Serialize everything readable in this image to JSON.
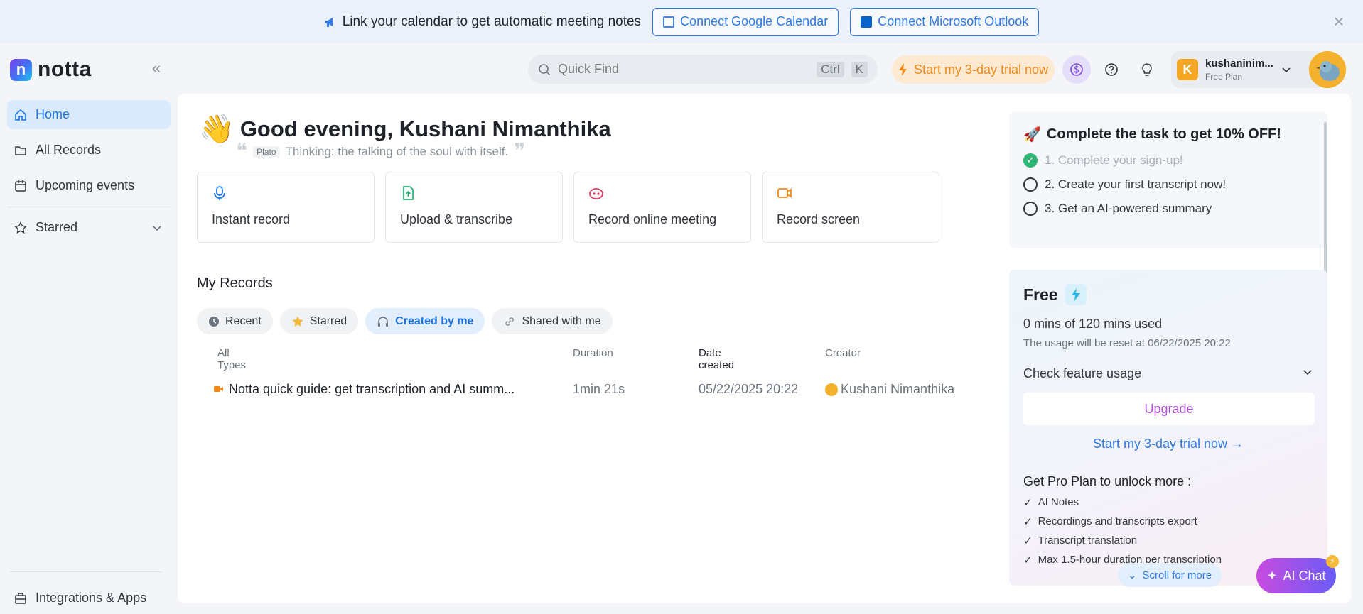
{
  "banner": {
    "text": "Link your calendar to get automatic meeting notes",
    "google_btn": "Connect Google Calendar",
    "outlook_btn": "Connect Microsoft Outlook",
    "close": "×"
  },
  "sidebar": {
    "logo": "notta",
    "logo_mark": "n",
    "collapse": "«",
    "items": [
      {
        "label": "Home"
      },
      {
        "label": "All Records"
      },
      {
        "label": "Upcoming events"
      },
      {
        "label": "Starred"
      }
    ],
    "integrations": "Integrations & Apps"
  },
  "header": {
    "search_placeholder": "Quick Find",
    "kbd_ctrl": "Ctrl",
    "kbd_k": "K",
    "trial": "Start my 3-day trial now",
    "user_initial": "K",
    "user_name": "kushaninim...",
    "user_plan": "Free Plan"
  },
  "main": {
    "greeting": "Good evening, Kushani Nimanthika",
    "quote_author": "Plato",
    "quote_text": "Thinking: the talking of the soul with itself.",
    "actions": [
      {
        "label": "Instant record"
      },
      {
        "label": "Upload & transcribe"
      },
      {
        "label": "Record online meeting"
      },
      {
        "label": "Record screen"
      }
    ],
    "my_records": "My Records",
    "filters": [
      {
        "label": "Recent"
      },
      {
        "label": "Starred"
      },
      {
        "label": "Created by me"
      },
      {
        "label": "Shared with me"
      }
    ],
    "table": {
      "headers": {
        "type": "All Types",
        "duration": "Duration",
        "date": "Date created",
        "creator": "Creator"
      },
      "rows": [
        {
          "title": "Notta quick guide: get transcription and AI summ...",
          "duration": "1min 21s",
          "date": "05/22/2025 20:22",
          "creator": "Kushani Nimanthika"
        }
      ]
    }
  },
  "tasks": {
    "title": "Complete the task to get 10% OFF!",
    "items": [
      {
        "label": "1. Complete your sign-up!",
        "done": true
      },
      {
        "label": "2. Create your first transcript now!",
        "done": false
      },
      {
        "label": "3. Get an AI-powered summary",
        "done": false
      }
    ]
  },
  "plan": {
    "title": "Free",
    "usage": "0 mins of 120 mins used",
    "reset": "The usage will be reset at 06/22/2025 20:22",
    "feature": "Check feature usage",
    "upgrade": "Upgrade",
    "trial_link": "Start my 3-day trial now →",
    "pro_title": "Get Pro Plan to unlock more :",
    "pro_items": [
      "AI Notes",
      "Recordings and transcripts export",
      "Transcript translation",
      "Max 1.5-hour duration per transcription"
    ]
  },
  "floating": {
    "scroll_more": "Scroll for more",
    "ai_chat": "AI Chat",
    "ai_badge": "⚡"
  },
  "colors": {
    "accent": "#1a73e8",
    "trial": "#f08a1b",
    "upgrade": "#b14fd3"
  }
}
